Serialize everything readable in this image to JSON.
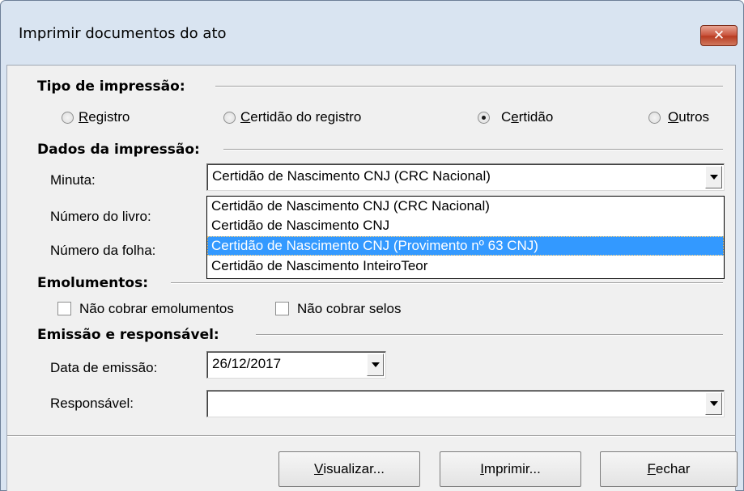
{
  "window": {
    "title": "Imprimir documentos do ato",
    "close_glyph": "✕"
  },
  "tipo": {
    "heading": "Tipo de impressão:",
    "options": [
      {
        "label": "Registro",
        "access_key": "R",
        "rest": "egistro",
        "checked": false
      },
      {
        "label": "Certidão do registro",
        "access_key": "C",
        "rest": "ertidão do registro",
        "checked": false
      },
      {
        "label": "Certidão",
        "access_key": "e",
        "pre": "C",
        "rest": "rtidão",
        "checked": true
      },
      {
        "label": "Outros",
        "access_key": "O",
        "rest": "utros",
        "checked": false
      }
    ]
  },
  "dados": {
    "heading": "Dados da impressão:",
    "minuta_label": "Minuta:",
    "minuta_value": "Certidão de Nascimento CNJ (CRC Nacional)",
    "livro_label": "Número do livro:",
    "folha_label": "Número da folha:",
    "dropdown_items": [
      {
        "text": "Certidão de Nascimento CNJ (CRC Nacional)",
        "selected": false
      },
      {
        "text": "Certidão de Nascimento CNJ",
        "selected": false
      },
      {
        "text": "Certidão de Nascimento CNJ (Provimento nº 63 CNJ)",
        "selected": true
      },
      {
        "text": "Certidão de Nascimento InteiroTeor",
        "selected": false
      }
    ]
  },
  "emolumentos": {
    "heading": "Emolumentos:",
    "nao_cobrar_emolumentos": "Não cobrar emolumentos",
    "nao_cobrar_selos": "Não cobrar selos"
  },
  "emissao": {
    "heading": "Emissão e responsável:",
    "data_label": "Data de emissão:",
    "data_value": "26/12/2017",
    "responsavel_label": "Responsável:",
    "responsavel_value": ""
  },
  "buttons": {
    "visualizar": {
      "key": "V",
      "rest": "isualizar..."
    },
    "imprimir": {
      "key": "I",
      "rest": "mprimir..."
    },
    "fechar": {
      "key": "F",
      "rest": "echar"
    }
  },
  "colors": {
    "selection": "#3399ff",
    "dialog_bg": "#f0f0f0",
    "frame": "#d9e4f1",
    "close_button": "#c8523a"
  }
}
